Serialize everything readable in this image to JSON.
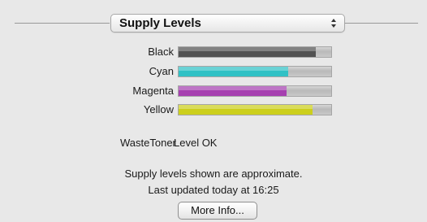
{
  "popup": {
    "selected": "Supply Levels"
  },
  "supplies": [
    {
      "label": "Black",
      "level": 0.9,
      "color": "#525252"
    },
    {
      "label": "Cyan",
      "level": 0.72,
      "color": "#31c1c5"
    },
    {
      "label": "Magenta",
      "level": 0.71,
      "color": "#a640b0"
    },
    {
      "label": "Yellow",
      "level": 0.88,
      "color": "#cccf1c"
    }
  ],
  "waste_toner": {
    "label": "WasteToner",
    "value": "Level OK"
  },
  "notes": {
    "approximate": "Supply levels shown are approximate.",
    "updated": "Last updated today at 16:25"
  },
  "more_info_button": {
    "label": "More Info..."
  }
}
